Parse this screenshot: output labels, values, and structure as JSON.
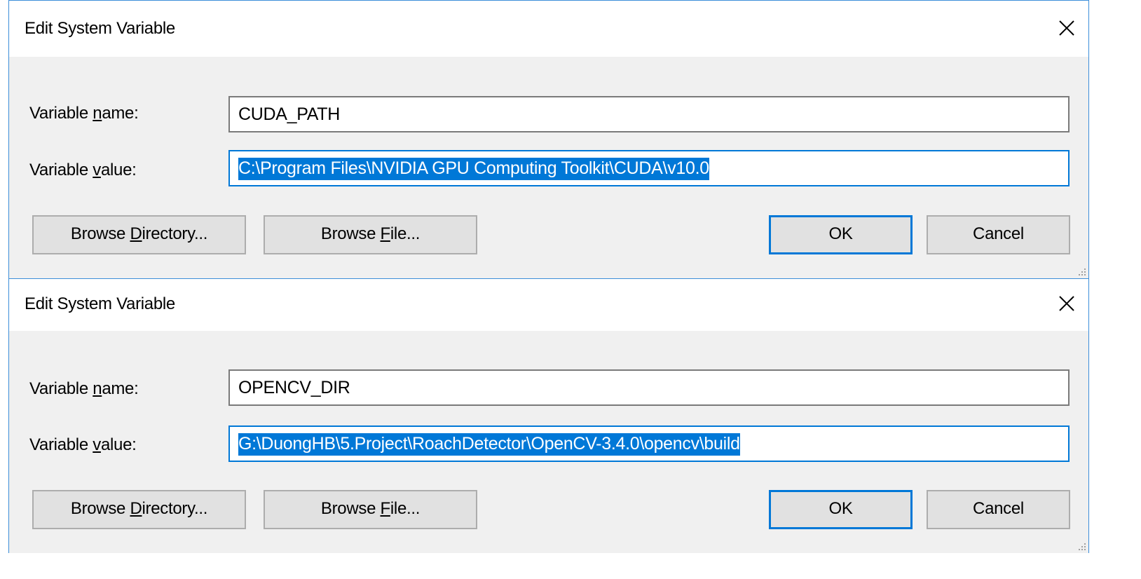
{
  "dialogs": [
    {
      "title": "Edit System Variable",
      "name_label_pre": "Variable ",
      "name_label_ul": "n",
      "name_label_post": "ame:",
      "value_label_pre": "Variable ",
      "value_label_ul": "v",
      "value_label_post": "alue:",
      "name_value": "CUDA_PATH",
      "value_value": "C:\\Program Files\\NVIDIA GPU Computing Toolkit\\CUDA\\v10.0",
      "browse_dir_pre": "Browse ",
      "browse_dir_ul": "D",
      "browse_dir_post": "irectory...",
      "browse_file_pre": "Browse ",
      "browse_file_ul": "F",
      "browse_file_post": "ile...",
      "ok_label": "OK",
      "cancel_label": "Cancel"
    },
    {
      "title": "Edit System Variable",
      "name_label_pre": "Variable ",
      "name_label_ul": "n",
      "name_label_post": "ame:",
      "value_label_pre": "Variable ",
      "value_label_ul": "v",
      "value_label_post": "alue:",
      "name_value": "OPENCV_DIR",
      "value_value": "G:\\DuongHB\\5.Project\\RoachDetector\\OpenCV-3.4.0\\opencv\\build",
      "browse_dir_pre": "Browse ",
      "browse_dir_ul": "D",
      "browse_dir_post": "irectory...",
      "browse_file_pre": "Browse ",
      "browse_file_ul": "F",
      "browse_file_post": "ile...",
      "ok_label": "OK",
      "cancel_label": "Cancel"
    }
  ],
  "icons": {
    "close": "close-icon",
    "resize_grip": "resize-grip-icon"
  },
  "colors": {
    "accent": "#0078d7",
    "dialog_bg": "#f0f0f0",
    "button_bg": "#e1e1e1",
    "window_border": "#3c8ed9"
  }
}
